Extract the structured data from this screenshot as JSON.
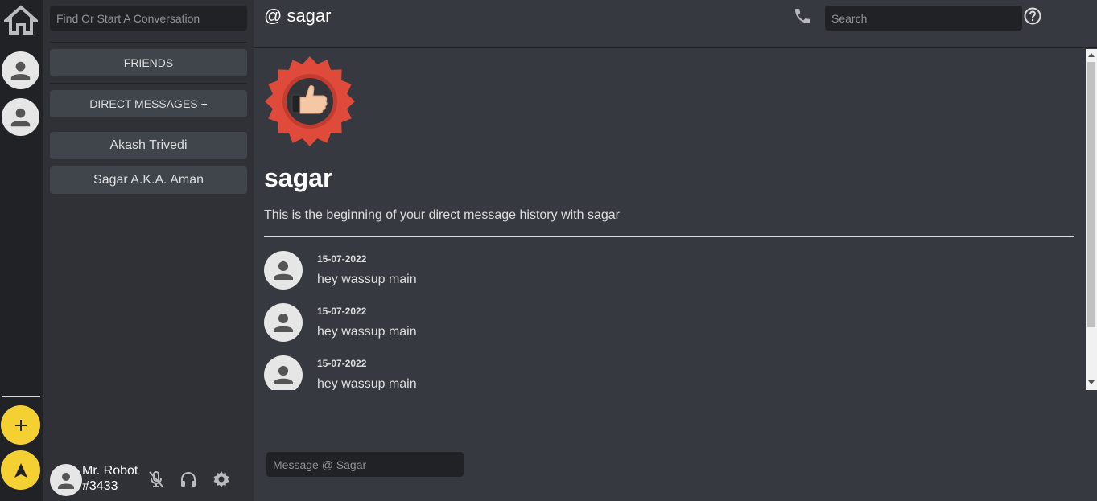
{
  "rail": {
    "home_icon": "home-icon",
    "add_icon": "plus-icon",
    "explore_icon": "compass-arrow-icon",
    "accent_color": "#f5d033"
  },
  "sidebar": {
    "search": {
      "placeholder": "Find Or Start A Conversation",
      "value": ""
    },
    "friends_label": "FRIENDS",
    "dm_header_label": "DIRECT MESSAGES +",
    "dms": [
      {
        "label": "Akash Trivedi"
      },
      {
        "label": "Sagar A.K.A. Aman"
      }
    ]
  },
  "user_panel": {
    "name": "Mr. Robot",
    "tag": "#3433",
    "icons": [
      "mic-off-icon",
      "headphones-icon",
      "gear-icon"
    ]
  },
  "header": {
    "title": "@ sagar",
    "search": {
      "placeholder": "Search",
      "value": ""
    },
    "icons": [
      "phone-icon",
      "help-icon"
    ]
  },
  "intro": {
    "name": "sagar",
    "text": "This is the beginning of your direct message history with sagar"
  },
  "messages": [
    {
      "date": "15-07-2022",
      "text": "hey wassup main"
    },
    {
      "date": "15-07-2022",
      "text": "hey wassup main"
    },
    {
      "date": "15-07-2022",
      "text": "hey wassup main"
    }
  ],
  "composer": {
    "placeholder": "Message @ Sagar",
    "value": ""
  },
  "colors": {
    "rail_bg": "#202225",
    "sidebar_bg": "#2f3136",
    "main_bg": "#36393f",
    "badge_red": "#e04a3b"
  }
}
